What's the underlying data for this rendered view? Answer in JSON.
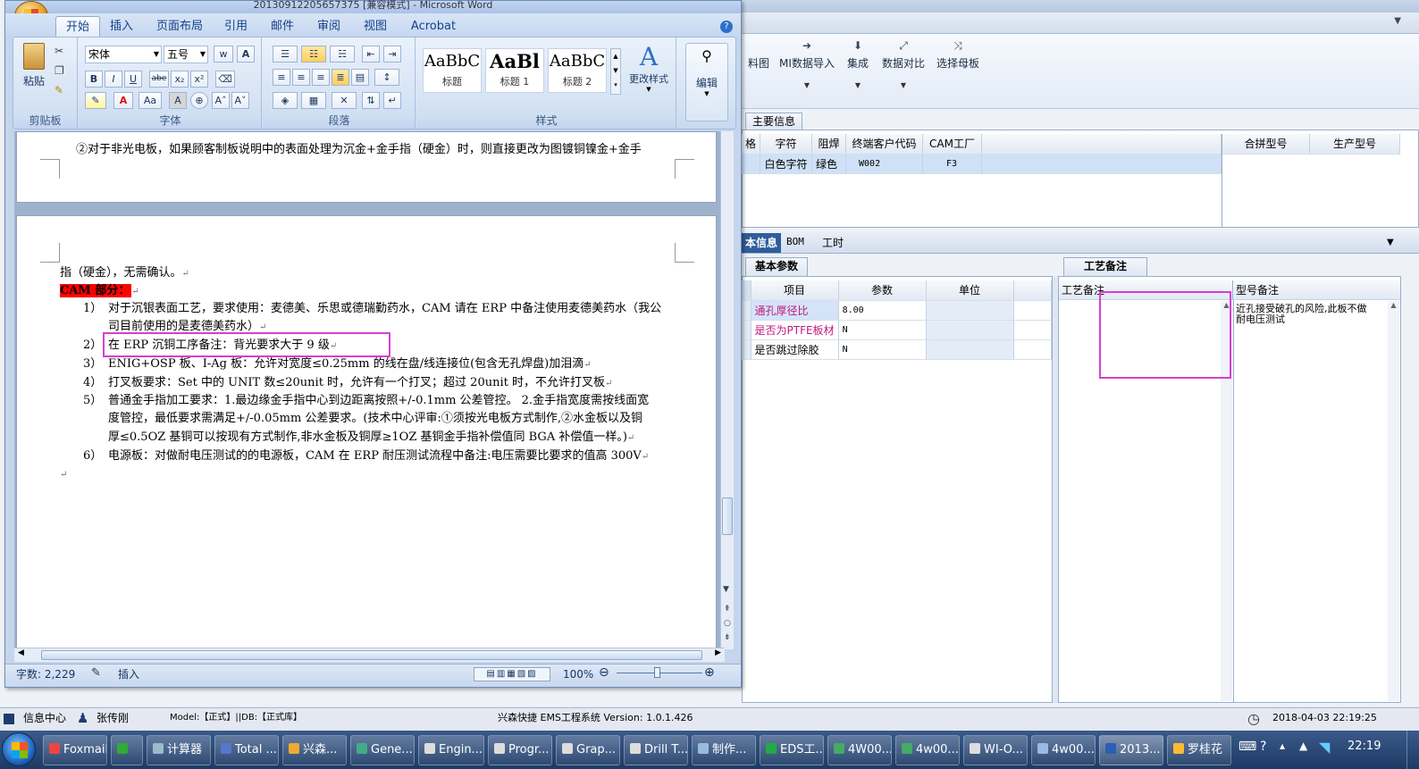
{
  "word": {
    "title": "20130912205657375 [兼容模式] - Microsoft Word",
    "tabs": [
      "开始",
      "插入",
      "页面布局",
      "引用",
      "邮件",
      "审阅",
      "视图",
      "Acrobat"
    ],
    "font_name": "宋体",
    "font_size": "五号",
    "group_labels": {
      "clipboard": "剪贴板",
      "font": "字体",
      "paragraph": "段落",
      "styles": "样式",
      "edit_group": "编辑"
    },
    "paste_label": "粘贴",
    "styles": [
      {
        "preview": "AaBbC",
        "name": "标题"
      },
      {
        "preview": "AaBl",
        "name": "标题 1"
      },
      {
        "preview": "AaBbC",
        "name": "标题 2"
      }
    ],
    "change_style_label": "更改样式",
    "edit_label": "编辑",
    "doc": {
      "page1_line": "②对于非光电板，如果顾客制板说明中的表面处理为沉金+金手指（硬金）时，则直接更改为图镀铜镍金+金手",
      "p_first": "指（硬金），无需确认。",
      "cam_heading": "CAM 部分：",
      "items": [
        {
          "num": "1）",
          "lines": [
            "对于沉银表面工艺，要求使用：麦德美、乐思或德瑞勤药水，CAM 请在 ERP 中备注使用麦德美药水（我公",
            "司目前使用的是麦德美药水）"
          ]
        },
        {
          "num": "2）",
          "lines": [
            "在 ERP 沉铜工序备注：背光要求大于 9 级"
          ]
        },
        {
          "num": "3）",
          "lines": [
            "ENIG+OSP 板、I-Ag 板：允许对宽度≤0.25mm 的线在盘/线连接位(包含无孔焊盘)加泪滴"
          ]
        },
        {
          "num": "4）",
          "lines": [
            "打叉板要求：Set 中的 UNIT 数≤20unit 时，允许有一个打叉；超过 20unit 时，不允许打叉板"
          ]
        },
        {
          "num": "5）",
          "lines": [
            "普通金手指加工要求：1.最边缘金手指中心到边距离按照+/-0.1mm 公差管控。 2.金手指宽度需按线面宽",
            "度管控，最低要求需满足+/-0.05mm 公差要求。(技术中心评审:①须按光电板方式制作,②水金板以及铜",
            "厚≤0.5OZ 基铜可以按现有方式制作,非水金板及铜厚≥1OZ 基铜金手指补偿值同 BGA 补偿值一样。)"
          ]
        },
        {
          "num": "6）",
          "lines": [
            "电源板：对做耐电压测试的的电源板，CAM 在 ERP 耐压测试流程中备注:电压需要比要求的值高 300V"
          ]
        }
      ]
    },
    "status": {
      "words": "字数: 2,229",
      "mode": "插入",
      "zoom": "100%"
    }
  },
  "erp": {
    "toolbar": [
      {
        "label": "料图",
        "icon": ""
      },
      {
        "label": "MI数据导入",
        "icon": "➜"
      },
      {
        "label": "集成",
        "icon": "⬇"
      },
      {
        "label": "数据对比",
        "icon": "⤢"
      },
      {
        "label": "选择母板",
        "icon": "⤨"
      }
    ],
    "main_info_tab": "主要信息",
    "main_headers": [
      "格",
      "字符",
      "阻焊",
      "终端客户代码",
      "CAM工厂"
    ],
    "main_row": [
      "",
      "白色字符",
      "绿色",
      "W002",
      "F3"
    ],
    "merge_headers": [
      "合拼型号",
      "生产型号"
    ],
    "sub_tabs": [
      "本信息",
      "BOM",
      "工时"
    ],
    "basic_tab": "基本参数",
    "param_headers": [
      "项目",
      "参数",
      "单位"
    ],
    "params": [
      {
        "name": "通孔厚径比",
        "value": "8.00",
        "unit": ""
      },
      {
        "name": "是否为PTFE板材",
        "value": "N",
        "unit": ""
      },
      {
        "name": "是否跳过除胶",
        "value": "N",
        "unit": ""
      }
    ],
    "process_tab": "工艺备注",
    "process_col": "工艺备注",
    "model_col": "型号备注",
    "model_note": [
      "近孔接受破孔的风险,此板不做",
      "耐电压测试"
    ]
  },
  "infobar": {
    "info_center": "信息中心",
    "user": "张传刚",
    "model": "Model:【正式】||DB:【正式库】",
    "system": "兴森快捷 EMS工程系统 Version: 1.0.1.426",
    "datetime": "2018-04-03 22:19:25"
  },
  "taskbar": {
    "items": [
      "Foxmail",
      "",
      "计算器",
      "Total ...",
      "兴森...",
      "Gene...",
      "Engin...",
      "Progr...",
      "Grap...",
      "Drill T...",
      "制作...",
      "EDS工...",
      "4W00...",
      "4w00...",
      "WI-O...",
      "4w00...",
      "2013...",
      "罗桂花"
    ],
    "clock": "22:19"
  },
  "colors": {
    "highlight_box": "#d63fd0",
    "cam_bg": "#ff0000",
    "pink_text": "#c2187e"
  }
}
